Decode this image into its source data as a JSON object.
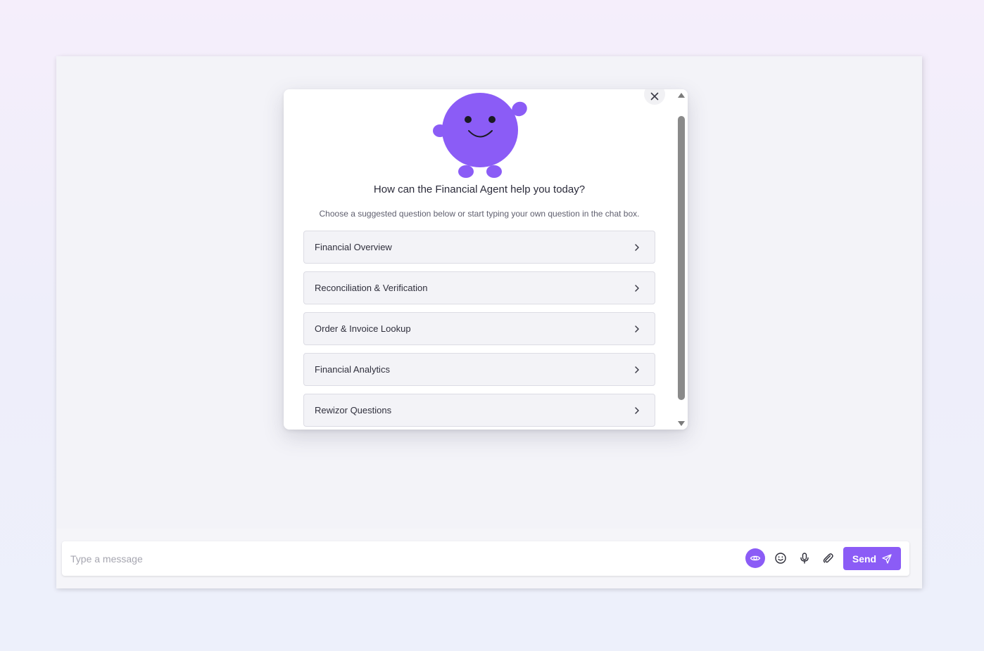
{
  "modal": {
    "heading": "How can the Financial Agent help you today?",
    "subheading": "Choose a suggested question below or start typing your own question in the chat box.",
    "close_icon": "close-icon",
    "options": [
      {
        "label": "Financial Overview"
      },
      {
        "label": "Reconciliation & Verification"
      },
      {
        "label": "Order & Invoice Lookup"
      },
      {
        "label": "Financial Analytics"
      },
      {
        "label": "Rewizor Questions"
      }
    ]
  },
  "composer": {
    "placeholder": "Type a message",
    "value": "",
    "send_label": "Send",
    "icons": [
      "eye-icon",
      "smile-icon",
      "microphone-icon",
      "paperclip-icon",
      "send-icon"
    ]
  },
  "colors": {
    "accent": "#8b5cf6",
    "mascot": "#8b5cf6"
  }
}
